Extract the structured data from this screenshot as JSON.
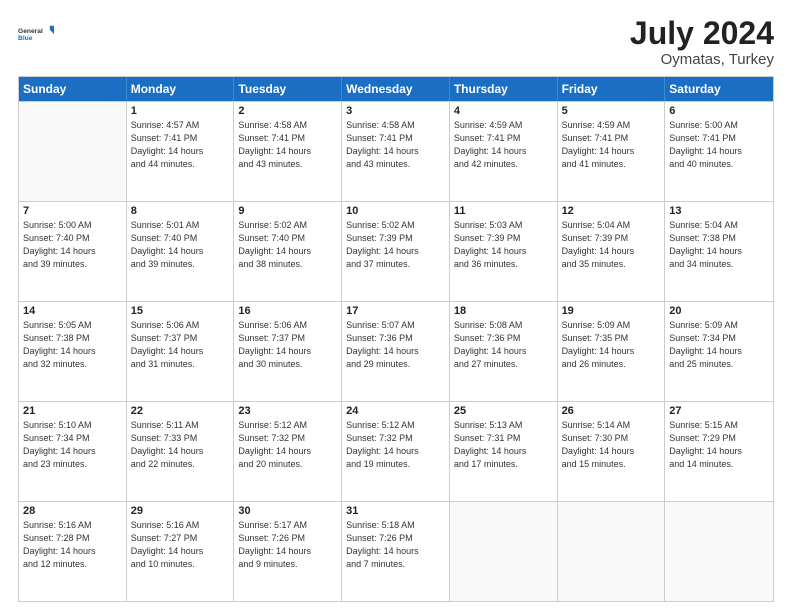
{
  "logo": {
    "general": "General",
    "blue": "Blue"
  },
  "title": {
    "month_year": "July 2024",
    "location": "Oymatas, Turkey"
  },
  "header_days": [
    "Sunday",
    "Monday",
    "Tuesday",
    "Wednesday",
    "Thursday",
    "Friday",
    "Saturday"
  ],
  "weeks": [
    [
      {
        "day": "",
        "empty": true
      },
      {
        "day": "1",
        "lines": [
          "Sunrise: 4:57 AM",
          "Sunset: 7:41 PM",
          "Daylight: 14 hours",
          "and 44 minutes."
        ]
      },
      {
        "day": "2",
        "lines": [
          "Sunrise: 4:58 AM",
          "Sunset: 7:41 PM",
          "Daylight: 14 hours",
          "and 43 minutes."
        ]
      },
      {
        "day": "3",
        "lines": [
          "Sunrise: 4:58 AM",
          "Sunset: 7:41 PM",
          "Daylight: 14 hours",
          "and 43 minutes."
        ]
      },
      {
        "day": "4",
        "lines": [
          "Sunrise: 4:59 AM",
          "Sunset: 7:41 PM",
          "Daylight: 14 hours",
          "and 42 minutes."
        ]
      },
      {
        "day": "5",
        "lines": [
          "Sunrise: 4:59 AM",
          "Sunset: 7:41 PM",
          "Daylight: 14 hours",
          "and 41 minutes."
        ]
      },
      {
        "day": "6",
        "lines": [
          "Sunrise: 5:00 AM",
          "Sunset: 7:41 PM",
          "Daylight: 14 hours",
          "and 40 minutes."
        ]
      }
    ],
    [
      {
        "day": "7",
        "lines": [
          "Sunrise: 5:00 AM",
          "Sunset: 7:40 PM",
          "Daylight: 14 hours",
          "and 39 minutes."
        ]
      },
      {
        "day": "8",
        "lines": [
          "Sunrise: 5:01 AM",
          "Sunset: 7:40 PM",
          "Daylight: 14 hours",
          "and 39 minutes."
        ]
      },
      {
        "day": "9",
        "lines": [
          "Sunrise: 5:02 AM",
          "Sunset: 7:40 PM",
          "Daylight: 14 hours",
          "and 38 minutes."
        ]
      },
      {
        "day": "10",
        "lines": [
          "Sunrise: 5:02 AM",
          "Sunset: 7:39 PM",
          "Daylight: 14 hours",
          "and 37 minutes."
        ]
      },
      {
        "day": "11",
        "lines": [
          "Sunrise: 5:03 AM",
          "Sunset: 7:39 PM",
          "Daylight: 14 hours",
          "and 36 minutes."
        ]
      },
      {
        "day": "12",
        "lines": [
          "Sunrise: 5:04 AM",
          "Sunset: 7:39 PM",
          "Daylight: 14 hours",
          "and 35 minutes."
        ]
      },
      {
        "day": "13",
        "lines": [
          "Sunrise: 5:04 AM",
          "Sunset: 7:38 PM",
          "Daylight: 14 hours",
          "and 34 minutes."
        ]
      }
    ],
    [
      {
        "day": "14",
        "lines": [
          "Sunrise: 5:05 AM",
          "Sunset: 7:38 PM",
          "Daylight: 14 hours",
          "and 32 minutes."
        ]
      },
      {
        "day": "15",
        "lines": [
          "Sunrise: 5:06 AM",
          "Sunset: 7:37 PM",
          "Daylight: 14 hours",
          "and 31 minutes."
        ]
      },
      {
        "day": "16",
        "lines": [
          "Sunrise: 5:06 AM",
          "Sunset: 7:37 PM",
          "Daylight: 14 hours",
          "and 30 minutes."
        ]
      },
      {
        "day": "17",
        "lines": [
          "Sunrise: 5:07 AM",
          "Sunset: 7:36 PM",
          "Daylight: 14 hours",
          "and 29 minutes."
        ]
      },
      {
        "day": "18",
        "lines": [
          "Sunrise: 5:08 AM",
          "Sunset: 7:36 PM",
          "Daylight: 14 hours",
          "and 27 minutes."
        ]
      },
      {
        "day": "19",
        "lines": [
          "Sunrise: 5:09 AM",
          "Sunset: 7:35 PM",
          "Daylight: 14 hours",
          "and 26 minutes."
        ]
      },
      {
        "day": "20",
        "lines": [
          "Sunrise: 5:09 AM",
          "Sunset: 7:34 PM",
          "Daylight: 14 hours",
          "and 25 minutes."
        ]
      }
    ],
    [
      {
        "day": "21",
        "lines": [
          "Sunrise: 5:10 AM",
          "Sunset: 7:34 PM",
          "Daylight: 14 hours",
          "and 23 minutes."
        ]
      },
      {
        "day": "22",
        "lines": [
          "Sunrise: 5:11 AM",
          "Sunset: 7:33 PM",
          "Daylight: 14 hours",
          "and 22 minutes."
        ]
      },
      {
        "day": "23",
        "lines": [
          "Sunrise: 5:12 AM",
          "Sunset: 7:32 PM",
          "Daylight: 14 hours",
          "and 20 minutes."
        ]
      },
      {
        "day": "24",
        "lines": [
          "Sunrise: 5:12 AM",
          "Sunset: 7:32 PM",
          "Daylight: 14 hours",
          "and 19 minutes."
        ]
      },
      {
        "day": "25",
        "lines": [
          "Sunrise: 5:13 AM",
          "Sunset: 7:31 PM",
          "Daylight: 14 hours",
          "and 17 minutes."
        ]
      },
      {
        "day": "26",
        "lines": [
          "Sunrise: 5:14 AM",
          "Sunset: 7:30 PM",
          "Daylight: 14 hours",
          "and 15 minutes."
        ]
      },
      {
        "day": "27",
        "lines": [
          "Sunrise: 5:15 AM",
          "Sunset: 7:29 PM",
          "Daylight: 14 hours",
          "and 14 minutes."
        ]
      }
    ],
    [
      {
        "day": "28",
        "lines": [
          "Sunrise: 5:16 AM",
          "Sunset: 7:28 PM",
          "Daylight: 14 hours",
          "and 12 minutes."
        ]
      },
      {
        "day": "29",
        "lines": [
          "Sunrise: 5:16 AM",
          "Sunset: 7:27 PM",
          "Daylight: 14 hours",
          "and 10 minutes."
        ]
      },
      {
        "day": "30",
        "lines": [
          "Sunrise: 5:17 AM",
          "Sunset: 7:26 PM",
          "Daylight: 14 hours",
          "and 9 minutes."
        ]
      },
      {
        "day": "31",
        "lines": [
          "Sunrise: 5:18 AM",
          "Sunset: 7:26 PM",
          "Daylight: 14 hours",
          "and 7 minutes."
        ]
      },
      {
        "day": "",
        "empty": true
      },
      {
        "day": "",
        "empty": true
      },
      {
        "day": "",
        "empty": true
      }
    ]
  ]
}
